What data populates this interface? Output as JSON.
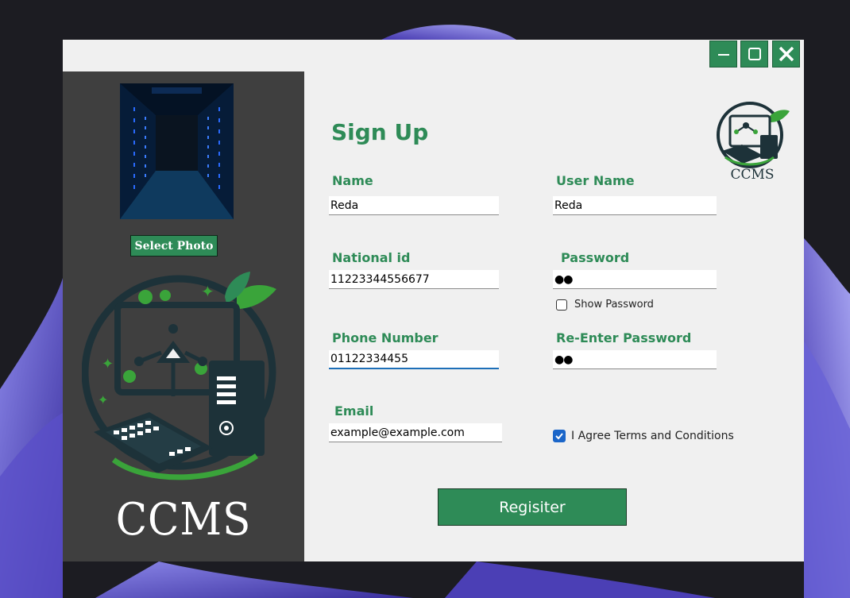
{
  "window": {
    "controls": {
      "minimize_icon": "minimize-icon",
      "maximize_icon": "maximize-icon",
      "close_icon": "close-icon"
    }
  },
  "sidebar": {
    "select_photo_label": "Select Photo",
    "brand": "CCMS"
  },
  "form": {
    "title": "Sign Up",
    "brand": "CCMS",
    "fields": {
      "name": {
        "label": "Name",
        "value": "Reda"
      },
      "username": {
        "label": "User Name",
        "value": "Reda"
      },
      "national_id": {
        "label": "National id",
        "value": "11223344556677"
      },
      "password": {
        "label": "Password",
        "value": "●●"
      },
      "phone": {
        "label": "Phone Number",
        "value": "01122334455"
      },
      "reenter_password": {
        "label": "Re-Enter Password",
        "value": "●●"
      },
      "email": {
        "label": "Email",
        "value": "example@example.com"
      }
    },
    "show_password": {
      "label": "Show Password",
      "checked": false
    },
    "agree_terms": {
      "label": "I Agree Terms and Conditions",
      "checked": true
    },
    "register_label": "Regisiter"
  },
  "colors": {
    "accent": "#2e8b57",
    "sidebar_bg": "#3f3f3f",
    "window_bg": "#f0f0f0",
    "checkbox_checked": "#1b66c9"
  }
}
